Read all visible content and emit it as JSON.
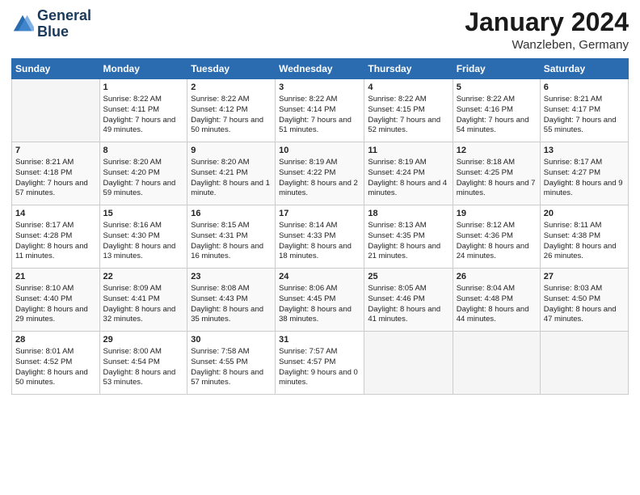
{
  "logo": {
    "line1": "General",
    "line2": "Blue"
  },
  "title": "January 2024",
  "location": "Wanzleben, Germany",
  "days_of_week": [
    "Sunday",
    "Monday",
    "Tuesday",
    "Wednesday",
    "Thursday",
    "Friday",
    "Saturday"
  ],
  "weeks": [
    [
      {
        "num": "",
        "empty": true
      },
      {
        "num": "1",
        "sunrise": "Sunrise: 8:22 AM",
        "sunset": "Sunset: 4:11 PM",
        "daylight": "Daylight: 7 hours and 49 minutes."
      },
      {
        "num": "2",
        "sunrise": "Sunrise: 8:22 AM",
        "sunset": "Sunset: 4:12 PM",
        "daylight": "Daylight: 7 hours and 50 minutes."
      },
      {
        "num": "3",
        "sunrise": "Sunrise: 8:22 AM",
        "sunset": "Sunset: 4:14 PM",
        "daylight": "Daylight: 7 hours and 51 minutes."
      },
      {
        "num": "4",
        "sunrise": "Sunrise: 8:22 AM",
        "sunset": "Sunset: 4:15 PM",
        "daylight": "Daylight: 7 hours and 52 minutes."
      },
      {
        "num": "5",
        "sunrise": "Sunrise: 8:22 AM",
        "sunset": "Sunset: 4:16 PM",
        "daylight": "Daylight: 7 hours and 54 minutes."
      },
      {
        "num": "6",
        "sunrise": "Sunrise: 8:21 AM",
        "sunset": "Sunset: 4:17 PM",
        "daylight": "Daylight: 7 hours and 55 minutes."
      }
    ],
    [
      {
        "num": "7",
        "sunrise": "Sunrise: 8:21 AM",
        "sunset": "Sunset: 4:18 PM",
        "daylight": "Daylight: 7 hours and 57 minutes."
      },
      {
        "num": "8",
        "sunrise": "Sunrise: 8:20 AM",
        "sunset": "Sunset: 4:20 PM",
        "daylight": "Daylight: 7 hours and 59 minutes."
      },
      {
        "num": "9",
        "sunrise": "Sunrise: 8:20 AM",
        "sunset": "Sunset: 4:21 PM",
        "daylight": "Daylight: 8 hours and 1 minute."
      },
      {
        "num": "10",
        "sunrise": "Sunrise: 8:19 AM",
        "sunset": "Sunset: 4:22 PM",
        "daylight": "Daylight: 8 hours and 2 minutes."
      },
      {
        "num": "11",
        "sunrise": "Sunrise: 8:19 AM",
        "sunset": "Sunset: 4:24 PM",
        "daylight": "Daylight: 8 hours and 4 minutes."
      },
      {
        "num": "12",
        "sunrise": "Sunrise: 8:18 AM",
        "sunset": "Sunset: 4:25 PM",
        "daylight": "Daylight: 8 hours and 7 minutes."
      },
      {
        "num": "13",
        "sunrise": "Sunrise: 8:17 AM",
        "sunset": "Sunset: 4:27 PM",
        "daylight": "Daylight: 8 hours and 9 minutes."
      }
    ],
    [
      {
        "num": "14",
        "sunrise": "Sunrise: 8:17 AM",
        "sunset": "Sunset: 4:28 PM",
        "daylight": "Daylight: 8 hours and 11 minutes."
      },
      {
        "num": "15",
        "sunrise": "Sunrise: 8:16 AM",
        "sunset": "Sunset: 4:30 PM",
        "daylight": "Daylight: 8 hours and 13 minutes."
      },
      {
        "num": "16",
        "sunrise": "Sunrise: 8:15 AM",
        "sunset": "Sunset: 4:31 PM",
        "daylight": "Daylight: 8 hours and 16 minutes."
      },
      {
        "num": "17",
        "sunrise": "Sunrise: 8:14 AM",
        "sunset": "Sunset: 4:33 PM",
        "daylight": "Daylight: 8 hours and 18 minutes."
      },
      {
        "num": "18",
        "sunrise": "Sunrise: 8:13 AM",
        "sunset": "Sunset: 4:35 PM",
        "daylight": "Daylight: 8 hours and 21 minutes."
      },
      {
        "num": "19",
        "sunrise": "Sunrise: 8:12 AM",
        "sunset": "Sunset: 4:36 PM",
        "daylight": "Daylight: 8 hours and 24 minutes."
      },
      {
        "num": "20",
        "sunrise": "Sunrise: 8:11 AM",
        "sunset": "Sunset: 4:38 PM",
        "daylight": "Daylight: 8 hours and 26 minutes."
      }
    ],
    [
      {
        "num": "21",
        "sunrise": "Sunrise: 8:10 AM",
        "sunset": "Sunset: 4:40 PM",
        "daylight": "Daylight: 8 hours and 29 minutes."
      },
      {
        "num": "22",
        "sunrise": "Sunrise: 8:09 AM",
        "sunset": "Sunset: 4:41 PM",
        "daylight": "Daylight: 8 hours and 32 minutes."
      },
      {
        "num": "23",
        "sunrise": "Sunrise: 8:08 AM",
        "sunset": "Sunset: 4:43 PM",
        "daylight": "Daylight: 8 hours and 35 minutes."
      },
      {
        "num": "24",
        "sunrise": "Sunrise: 8:06 AM",
        "sunset": "Sunset: 4:45 PM",
        "daylight": "Daylight: 8 hours and 38 minutes."
      },
      {
        "num": "25",
        "sunrise": "Sunrise: 8:05 AM",
        "sunset": "Sunset: 4:46 PM",
        "daylight": "Daylight: 8 hours and 41 minutes."
      },
      {
        "num": "26",
        "sunrise": "Sunrise: 8:04 AM",
        "sunset": "Sunset: 4:48 PM",
        "daylight": "Daylight: 8 hours and 44 minutes."
      },
      {
        "num": "27",
        "sunrise": "Sunrise: 8:03 AM",
        "sunset": "Sunset: 4:50 PM",
        "daylight": "Daylight: 8 hours and 47 minutes."
      }
    ],
    [
      {
        "num": "28",
        "sunrise": "Sunrise: 8:01 AM",
        "sunset": "Sunset: 4:52 PM",
        "daylight": "Daylight: 8 hours and 50 minutes."
      },
      {
        "num": "29",
        "sunrise": "Sunrise: 8:00 AM",
        "sunset": "Sunset: 4:54 PM",
        "daylight": "Daylight: 8 hours and 53 minutes."
      },
      {
        "num": "30",
        "sunrise": "Sunrise: 7:58 AM",
        "sunset": "Sunset: 4:55 PM",
        "daylight": "Daylight: 8 hours and 57 minutes."
      },
      {
        "num": "31",
        "sunrise": "Sunrise: 7:57 AM",
        "sunset": "Sunset: 4:57 PM",
        "daylight": "Daylight: 9 hours and 0 minutes."
      },
      {
        "num": "",
        "empty": true
      },
      {
        "num": "",
        "empty": true
      },
      {
        "num": "",
        "empty": true
      }
    ]
  ]
}
